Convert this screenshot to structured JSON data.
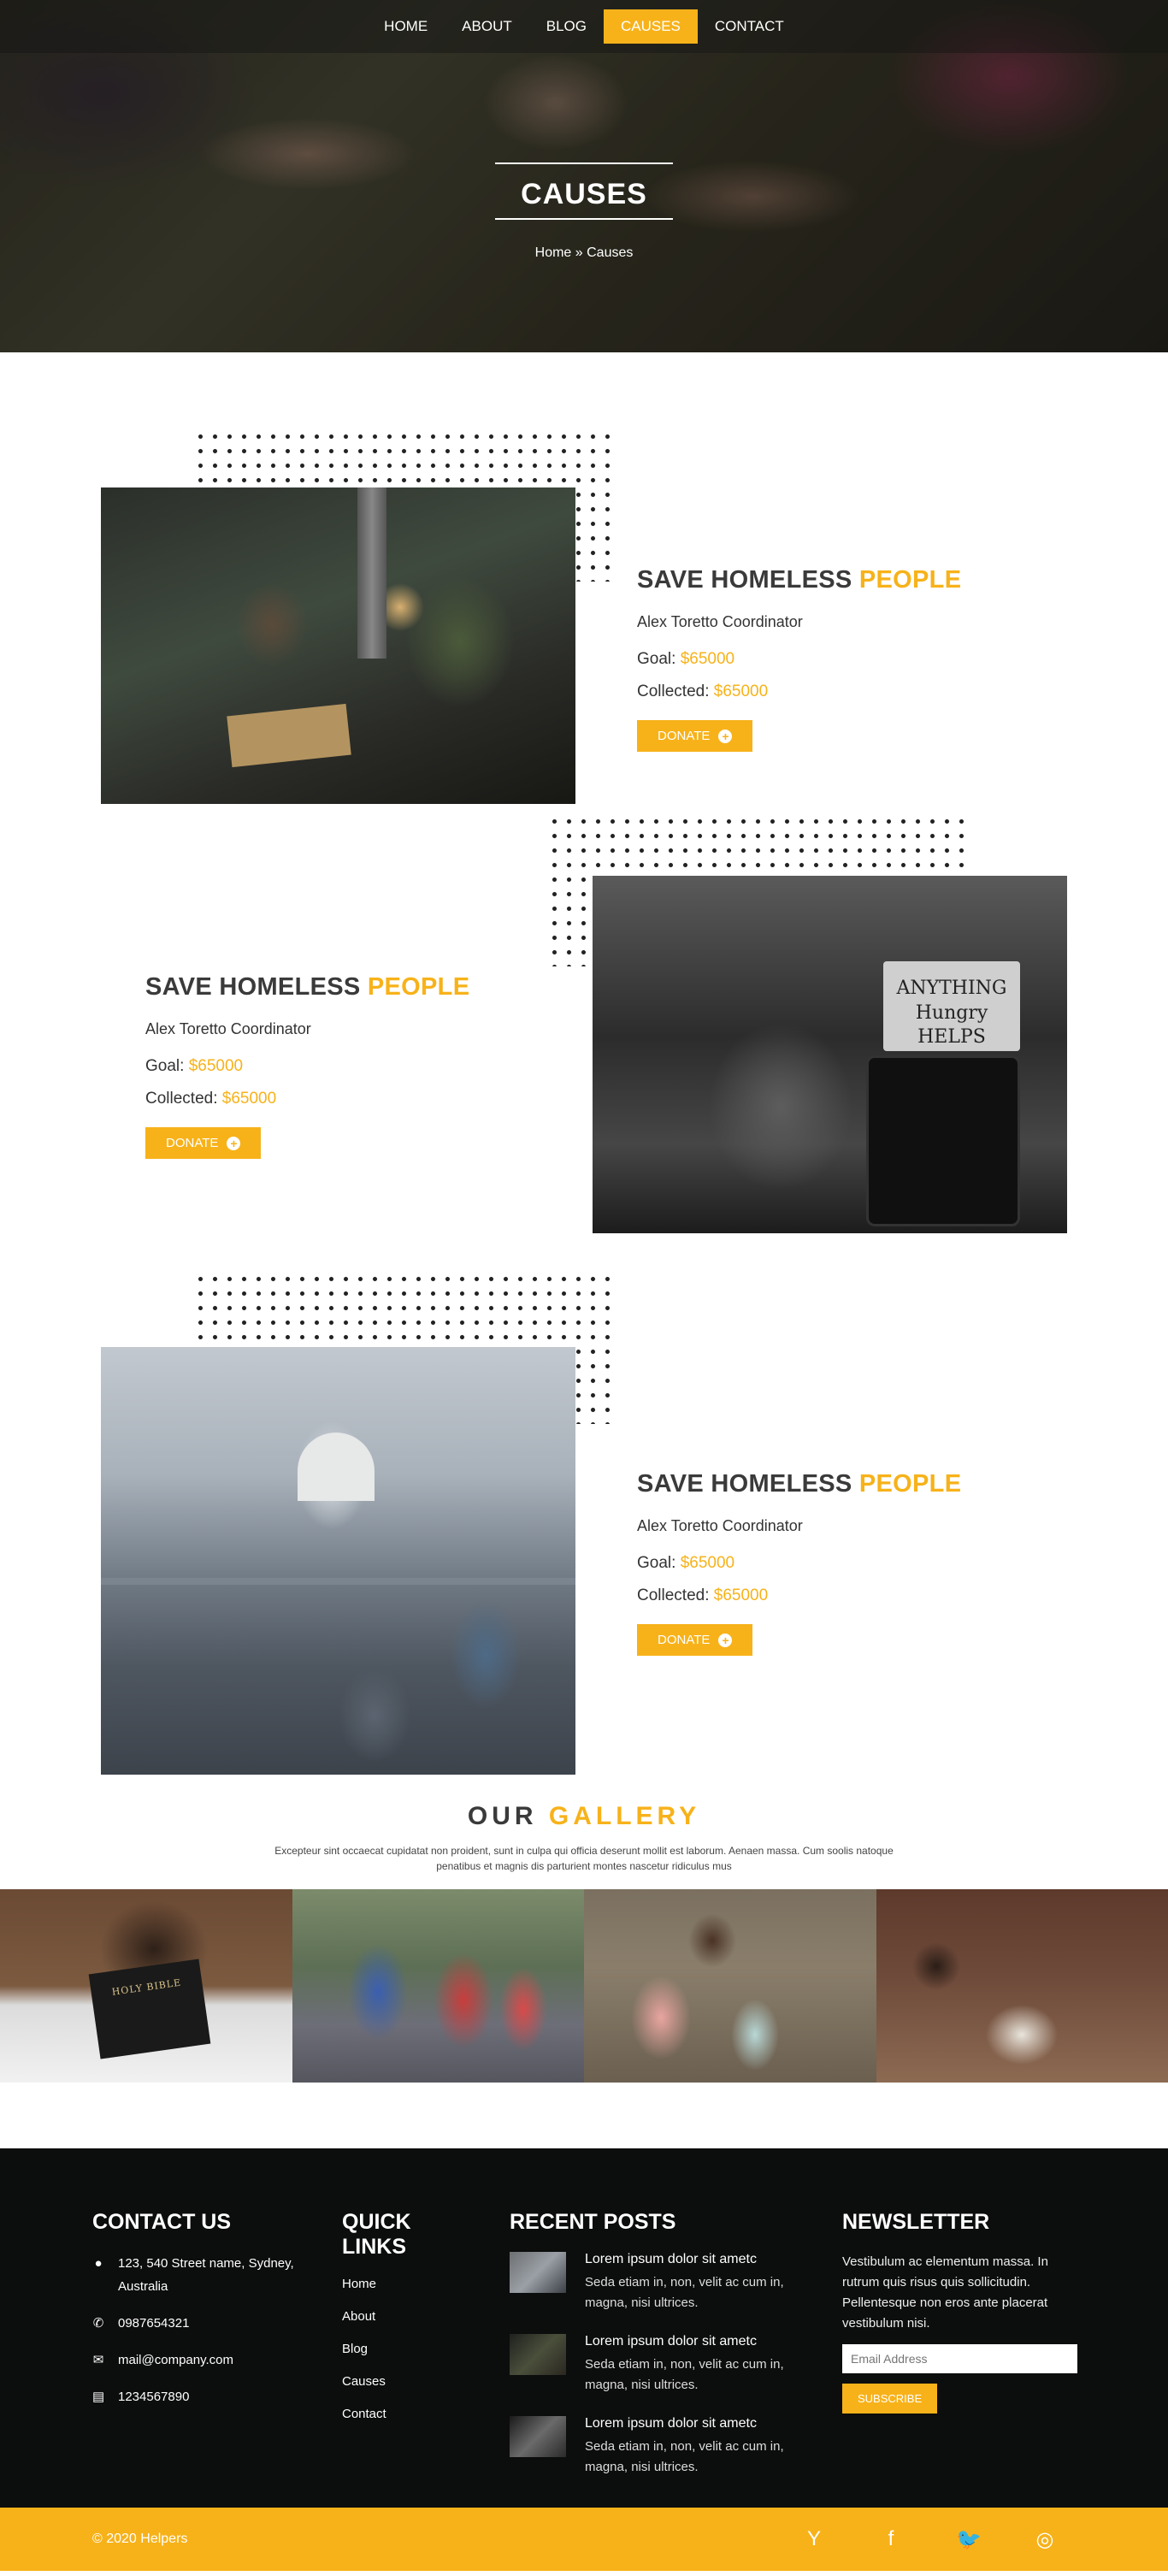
{
  "nav": {
    "items": [
      "HOME",
      "ABOUT",
      "BLOG",
      "CAUSES",
      "CONTACT"
    ],
    "active": "CAUSES"
  },
  "hero": {
    "title": "CAUSES",
    "breadcrumb": "Home » Causes"
  },
  "causes": [
    {
      "title": "SAVE HOMELESS",
      "title_highlight": "PEOPLE",
      "subtitle": "Alex Toretto Coordinator",
      "goal_label": "Goal:",
      "goal": "$65000",
      "collected_label": "Collected:",
      "collected": "$65000",
      "button": "DONATE"
    },
    {
      "title": "SAVE HOMELESS",
      "title_highlight": "PEOPLE",
      "subtitle": "Alex Toretto Coordinator",
      "goal_label": "Goal:",
      "goal": "$65000",
      "collected_label": "Collected:",
      "collected": "$65000",
      "button": "DONATE",
      "sign_text": "ANYTHING Hungry HELPS"
    },
    {
      "title": "SAVE HOMELESS",
      "title_highlight": "PEOPLE",
      "subtitle": "Alex Toretto Coordinator",
      "goal_label": "Goal:",
      "goal": "$65000",
      "collected_label": "Collected:",
      "collected": "$65000",
      "button": "DONATE"
    }
  ],
  "gallery": {
    "title": "OUR",
    "title_highlight": "GALLERY",
    "description": "Excepteur sint occaecat cupidatat non proident, sunt in culpa qui officia deserunt mollit est laborum. Aenaen massa. Cum soolis natoque penatibus et magnis dis parturient montes nascetur ridiculus mus",
    "book_text": "HOLY BIBLE"
  },
  "footer": {
    "contact": {
      "heading": "CONTACT US",
      "address": "123, 540 Street name, Sydney, Australia",
      "phone": "0987654321",
      "email": "mail@company.com",
      "fax": "1234567890"
    },
    "links": {
      "heading": "QUICK LINKS",
      "items": [
        "Home",
        "About",
        "Blog",
        "Causes",
        "Contact"
      ]
    },
    "posts": {
      "heading": "RECENT POSTS",
      "items": [
        {
          "title": "Lorem ipsum dolor sit ametc",
          "text": "Seda etiam in, non, velit ac cum in, magna, nisi ultrices."
        },
        {
          "title": "Lorem ipsum dolor sit ametc",
          "text": "Seda etiam in, non, velit ac cum in, magna, nisi ultrices."
        },
        {
          "title": "Lorem ipsum dolor sit ametc",
          "text": "Seda etiam in, non, velit ac cum in, magna, nisi ultrices."
        }
      ]
    },
    "newsletter": {
      "heading": "NEWSLETTER",
      "text": "Vestibulum ac elementum massa. In rutrum quis risus quis sollicitudin. Pellentesque non eros ante placerat vestibulum nisi.",
      "placeholder": "Email Address",
      "button": "SUBSCRIBE"
    }
  },
  "bottom": {
    "copyright": "© 2020 Helpers",
    "socials": [
      {
        "name": "y-combinator-icon",
        "glyph": "Y"
      },
      {
        "name": "facebook-icon",
        "glyph": "f"
      },
      {
        "name": "twitter-icon",
        "glyph": "🐦"
      },
      {
        "name": "instagram-icon",
        "glyph": "◎"
      }
    ]
  },
  "colors": {
    "accent": "#f7b21a",
    "footer_bg": "#0c0d0d"
  }
}
